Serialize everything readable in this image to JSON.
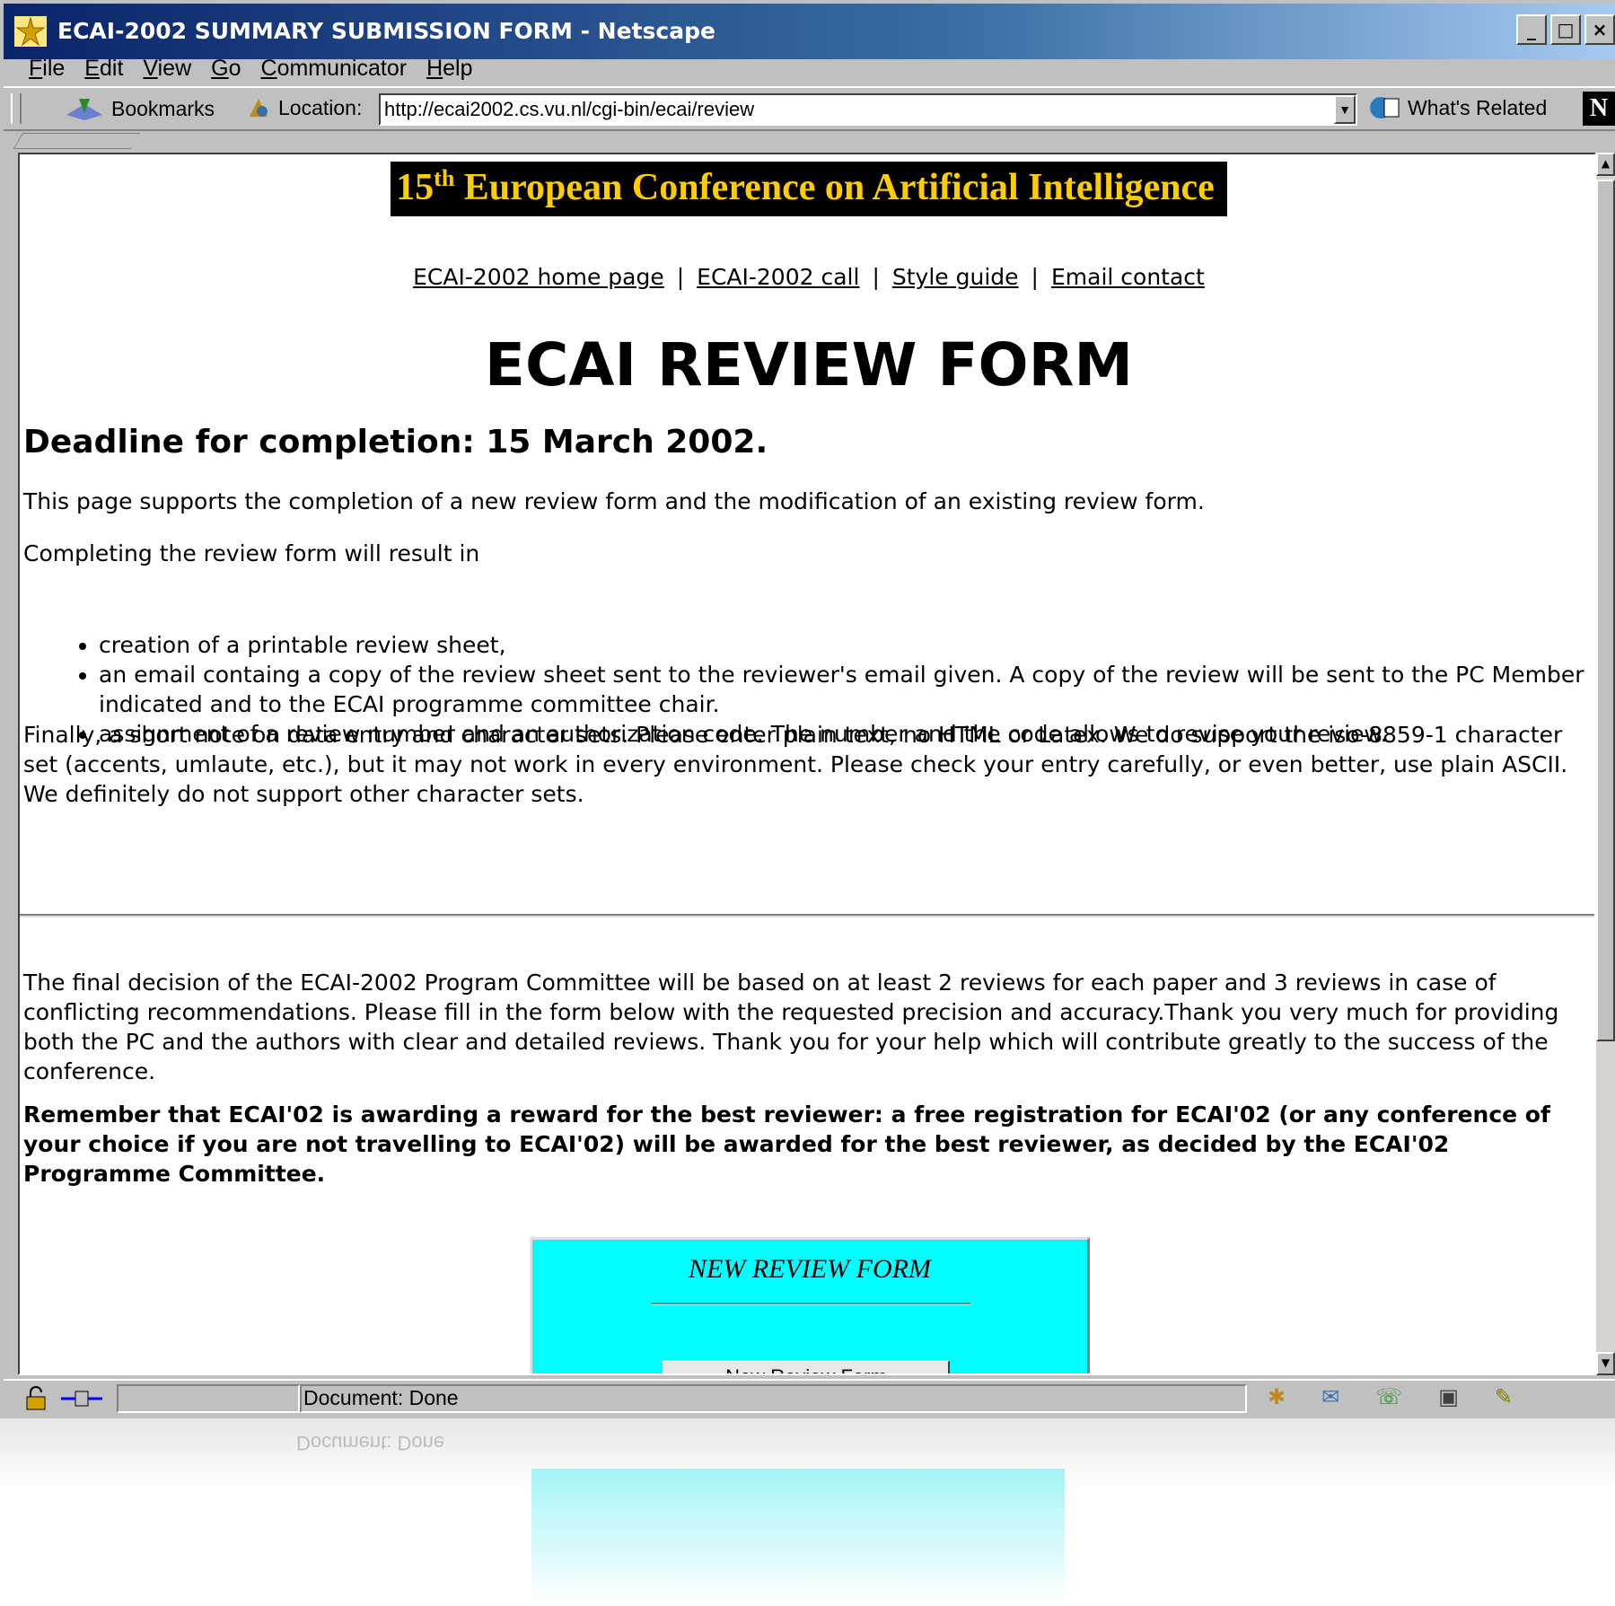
{
  "window": {
    "title": "ECAI-2002 SUMMARY SUBMISSION FORM - Netscape",
    "controls": [
      "_",
      "□",
      "×"
    ]
  },
  "menu": [
    "File",
    "Edit",
    "View",
    "Go",
    "Communicator",
    "Help"
  ],
  "toolbar": {
    "bookmarks_label": "Bookmarks",
    "location_label": "Location:",
    "url": "http://ecai2002.cs.vu.nl/cgi-bin/ecai/review",
    "related_label": "What's Related",
    "logo": "N"
  },
  "page": {
    "banner_number": "15",
    "banner_suffix": "th",
    "banner_text": " European Conference on Artificial Intelligence",
    "nav_links": [
      "ECAI-2002 home page",
      "ECAI-2002 call",
      "Style guide",
      "Email contact"
    ],
    "nav_separator": "|",
    "title": "ECAI REVIEW FORM",
    "deadline": "Deadline for completion: 15 March 2002.",
    "intro": "This page supports the completion of a new review form and the modification of an existing review form.",
    "result_intro": "Completing the review form will result in",
    "bullets": [
      "creation of a printable review sheet,",
      "an email containg a copy of the review sheet sent to the reviewer's email given. A copy of the review will be sent to the PC Member indicated and to the ECAI programme committee chair.",
      "assignment of a review number and an authorization code. The number and the code allows to revise your review."
    ],
    "charset_note": "Finally, a short note on data entry and character sets. Please enter plain text, no HTML or Latex. We do support the iso-8859-1 character set (accents, umlaute, etc.), but it may not work in every environment. Please check your entry carefully, or even better, use plain ASCII. We definitely do not support other character sets.",
    "decision_note": "The final decision of the ECAI-2002 Program Committee will be based on at least 2 reviews for each paper and 3 reviews in case of conflicting recommendations. Please fill in the form below with the requested precision and accuracy.Thank you very much for providing both the PC and the authors with clear and detailed reviews. Thank you for your help which will contribute greatly to the success of the conference.",
    "reward_note": "Remember that ECAI'02 is awarding a reward for the best reviewer: a free registration for ECAI'02 (or any conference of your choice if you are not travelling to ECAI'02) will be awarded for the best reviewer, as decided by the ECAI'02 Programme Committee.",
    "new_form_title": "NEW REVIEW FORM",
    "new_form_button": "New Review Form"
  },
  "status": {
    "text": "Document: Done"
  },
  "colors": {
    "banner_bg": "#000000",
    "banner_text": "#ffcc00",
    "new_form_bg": "#00ffff",
    "titlebar": "#0a246a"
  }
}
